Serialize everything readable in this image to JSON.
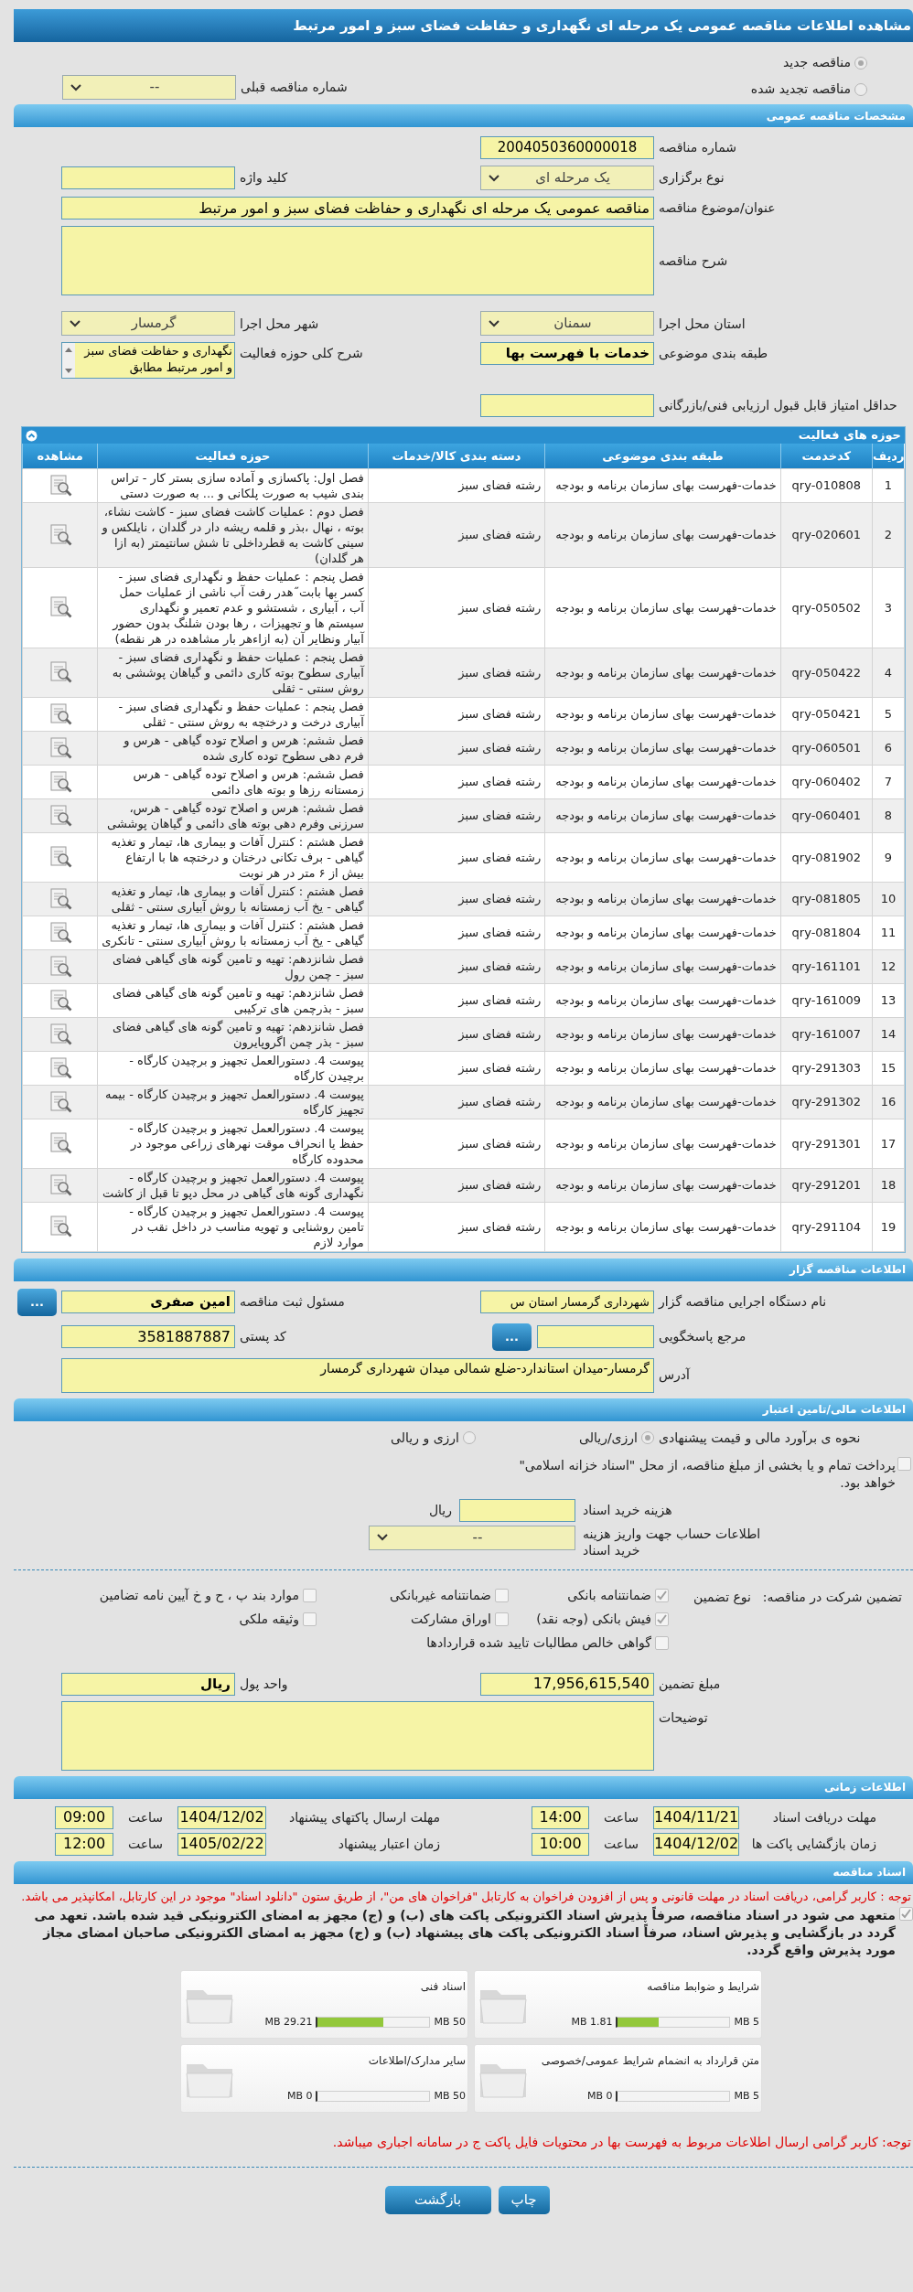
{
  "title": "مشاهده اطلاعات مناقصه عمومی یک مرحله ای نگهداری و حفاظت فضای سبز و امور مرتبط",
  "tender_type": [
    {
      "label": "مناقصه جدید",
      "selected": true
    },
    {
      "label": "مناقصه تجدید شده",
      "selected": false
    }
  ],
  "previous_tender": {
    "label": "شماره مناقصه قبلی",
    "value": "--"
  },
  "general": {
    "header": "مشخصات مناقصه عمومی",
    "tender_number": {
      "label": "شماره مناقصه",
      "value": "2004050360000018"
    },
    "holding_type": {
      "label": "نوع برگزاری",
      "value": "یک مرحله ای"
    },
    "keyword": {
      "label": "کلید واژه"
    },
    "subject": {
      "label": "عنوان/موضوع مناقصه",
      "value": "مناقصه عمومی یک مرحله ای نگهداری و حفاظت فضای سبز و امور مرتبط"
    },
    "description": {
      "label": "شرح مناقصه"
    },
    "province": {
      "label": "استان محل اجرا",
      "value": "سمنان"
    },
    "city": {
      "label": "شهر محل اجرا",
      "value": "گرمسار"
    },
    "category": {
      "label": "طبقه بندی موضوعی",
      "value": "خدمات با فهرست بها"
    },
    "activity_summary": {
      "label": "شرح کلی حوزه فعالیت",
      "value": "نگهداری و حفاظت فضای سبز و امور مرتبط مطابق"
    },
    "min_score": {
      "label": "حداقل امتیاز قابل قبول ارزیابی فنی/بازرگانی"
    }
  },
  "activities": {
    "header": "حوزه های فعالیت",
    "columns": [
      "ردیف",
      "کدخدمت",
      "طبقه بندی موضوعی",
      "دسته بندی کالا/خدمات",
      "حوزه فعالیت",
      "مشاهده"
    ],
    "rows": [
      {
        "index": "1",
        "code": "qry-010808",
        "category": "خدمات-فهرست بهای سازمان برنامه و بودجه",
        "group": "رشته فضای سبز",
        "activity": "فصل اول:  پاکسازی و آماده سازی بستر کار - تراس بندی شیب به صورت پلکانی و ... به صورت دستی"
      },
      {
        "index": "2",
        "code": "qry-020601",
        "category": "خدمات-فهرست بهای سازمان برنامه و بودجه",
        "group": "رشته فضای سبز",
        "activity": "فصل دوم : عملیات کاشت فضای سبز -  کاشت نشاء، بوته ، نهال ،بذر و قلمه ریشه دار در گلدان ، نایلکس و سینی کاشت به قطرداخلی تا شش سانتیمتر (به ازا هر  گلدان)"
      },
      {
        "index": "3",
        "code": "qry-050502",
        "category": "خدمات-فهرست بهای سازمان برنامه و بودجه",
        "group": "رشته فضای سبز",
        "activity": "فصل پنجم : عملیات حفظ و نگهداری فضای سبز - کسر بها بابت˝هدر رفت آب ناشی از عملیات حمل آب ، آبیاری ، شستشو و عدم تعمیر و نگهداری سیستم ها و تجهیزات ، رها بودن شلنگ بدون حضور آبیار ونظایر آن (به ازاءهر بار مشاهده در هر نقطه)"
      },
      {
        "index": "4",
        "code": "qry-050422",
        "category": "خدمات-فهرست بهای سازمان برنامه و بودجه",
        "group": "رشته فضای سبز",
        "activity": "فصل پنجم : عملیات حفظ و نگهداری فضای سبز - آبیاری سطوح بوته کاری دائمی  و گیاهان پوششی به روش سنتی - ثقلی"
      },
      {
        "index": "5",
        "code": "qry-050421",
        "category": "خدمات-فهرست بهای سازمان برنامه و بودجه",
        "group": "رشته فضای سبز",
        "activity": "فصل پنجم : عملیات حفظ و نگهداری فضای سبز - آبیاری درخت و درختچه به روش  سنتی - ثقلی"
      },
      {
        "index": "6",
        "code": "qry-060501",
        "category": "خدمات-فهرست بهای سازمان برنامه و بودجه",
        "group": "رشته فضای سبز",
        "activity": "فصل ششم: هرس و اصلاح توده گیاهی - هرس و فرم دهی سطوح توده کاری شده"
      },
      {
        "index": "7",
        "code": "qry-060402",
        "category": "خدمات-فهرست بهای سازمان برنامه و بودجه",
        "group": "رشته فضای سبز",
        "activity": "فصل ششم: هرس و اصلاح توده گیاهی - هرس زمستانه رزها و بوته های دائمی"
      },
      {
        "index": "8",
        "code": "qry-060401",
        "category": "خدمات-فهرست بهای سازمان برنامه و بودجه",
        "group": "رشته فضای سبز",
        "activity": "فصل ششم: هرس و اصلاح توده گیاهی - هرس، سرزنی  وفرم دهی بوته های دائمی و گیاهان پوششی"
      },
      {
        "index": "9",
        "code": "qry-081902",
        "category": "خدمات-فهرست بهای سازمان برنامه و بودجه",
        "group": "رشته فضای سبز",
        "activity": "فصل هشتم : کنترل آفات و بیماری ها، تیمار و تغذیه گیاهی - برف تکانی درختان و درختچه ها با ارتفاع بیش از ۶ متر در هر نوبت"
      },
      {
        "index": "10",
        "code": "qry-081805",
        "category": "خدمات-فهرست بهای سازمان برنامه و بودجه",
        "group": "رشته فضای سبز",
        "activity": "فصل هشتم : کنترل آفات و بیماری ها، تیمار و تغذیه گیاهی - یخ آب زمستانه با روش آبیاری سنتی - ثقلی"
      },
      {
        "index": "11",
        "code": "qry-081804",
        "category": "خدمات-فهرست بهای سازمان برنامه و بودجه",
        "group": "رشته فضای سبز",
        "activity": "فصل هشتم : کنترل آفات و بیماری ها، تیمار و تغذیه گیاهی - یخ آب زمستانه با روش آبیاری سنتی - تانکری"
      },
      {
        "index": "12",
        "code": "qry-161101",
        "category": "خدمات-فهرست بهای سازمان برنامه و بودجه",
        "group": "رشته فضای سبز",
        "activity": "فصل شانزدهم: تهیه و تامین گونه های گیاهی فضای سبز - چمن رول"
      },
      {
        "index": "13",
        "code": "qry-161009",
        "category": "خدمات-فهرست بهای سازمان برنامه و بودجه",
        "group": "رشته فضای سبز",
        "activity": "فصل شانزدهم: تهیه و تامین گونه های گیاهی فضای سبز - بذرچمن های ترکیبی"
      },
      {
        "index": "14",
        "code": "qry-161007",
        "category": "خدمات-فهرست بهای سازمان برنامه و بودجه",
        "group": "رشته فضای سبز",
        "activity": "فصل شانزدهم: تهیه و تامین گونه های گیاهی فضای سبز - بذر چمن اگروپایرون"
      },
      {
        "index": "15",
        "code": "qry-291303",
        "category": "خدمات-فهرست بهای سازمان برنامه و بودجه",
        "group": "رشته فضای سبز",
        "activity": "پیوست 4. دستورالعمل تجهیز و برچیدن کارگاه - برچیدن کارگاه"
      },
      {
        "index": "16",
        "code": "qry-291302",
        "category": "خدمات-فهرست بهای سازمان برنامه و بودجه",
        "group": "رشته فضای سبز",
        "activity": "پیوست 4. دستورالعمل تجهیز و برچیدن کارگاه - بیمه تجهیز کارگاه"
      },
      {
        "index": "17",
        "code": "qry-291301",
        "category": "خدمات-فهرست بهای سازمان برنامه و بودجه",
        "group": "رشته فضای سبز",
        "activity": "پیوست 4. دستورالعمل تجهیز و برچیدن کارگاه - حفظ یا انحراف موقت نهرهای زراعی موجود در محدوده کارگاه"
      },
      {
        "index": "18",
        "code": "qry-291201",
        "category": "خدمات-فهرست بهای سازمان برنامه و بودجه",
        "group": "رشته فضای سبز",
        "activity": "پیوست 4. دستورالعمل تجهیز و برچیدن کارگاه - نگهداری گونه های گیاهی در محل دپو تا قبل از کاشت"
      },
      {
        "index": "19",
        "code": "qry-291104",
        "category": "خدمات-فهرست بهای سازمان برنامه و بودجه",
        "group": "رشته فضای سبز",
        "activity": "پیوست 4. دستورالعمل تجهیز و برچیدن کارگاه - تامین روشنایی و تهویه مناسب در داخل نقب در موارد لازم"
      }
    ]
  },
  "organizer": {
    "header": "اطلاعات مناقصه گزار",
    "org_name": {
      "label": "نام دستگاه اجرایی مناقصه گزار",
      "value": "شهرداری گرمسار استان س"
    },
    "registrar": {
      "label": "مسئول ثبت مناقصه",
      "value": "امین صفری",
      "button": "..."
    },
    "responder": {
      "label": "مرجع پاسخگویی",
      "button": "..."
    },
    "postal_code": {
      "label": "کد پستی",
      "value": "3581887887"
    },
    "address": {
      "label": "آدرس",
      "value": "گرمسار-میدان استاندارد-ضلع شمالی میدان شهرداری گرمسار"
    }
  },
  "financial": {
    "header": "اطلاعات مالی/تامین اعتبار",
    "estimate": {
      "label": "نحوه ی برآورد مالی و قیمت پیشنهادی",
      "options": [
        {
          "label": "ارزی/ریالی",
          "selected": true
        },
        {
          "label": "ارزی و ریالی",
          "selected": false
        }
      ]
    },
    "treasury": {
      "label": "پرداخت تمام و یا بخشی از مبلغ مناقصه، از محل \"اسناد خزانه اسلامی\" خواهد بود.",
      "checked": false
    },
    "doc_fee": {
      "label": "هزینه خرید اسناد",
      "unit": "ریال"
    },
    "account": {
      "label": "اطلاعات حساب جهت واریز هزینه خرید اسناد",
      "value": "--"
    },
    "guarantee": {
      "label": "تضمین شرکت در مناقصه:",
      "type_label": "نوع تضمین",
      "options": [
        {
          "label": "ضمانتنامه بانکی",
          "checked": true
        },
        {
          "label": "ضمانتنامه غیربانکی",
          "checked": false
        },
        {
          "label": "موارد بند پ ، ح و خ آیین نامه تضامین",
          "checked": false
        },
        {
          "label": "فیش بانکی (وجه نقد)",
          "checked": true
        },
        {
          "label": "اوراق مشارکت",
          "checked": false
        },
        {
          "label": "وثیقه ملکی",
          "checked": false
        },
        {
          "label": "گواهی خالص مطالبات تایید شده قراردادها",
          "checked": false
        }
      ]
    },
    "amount": {
      "label": "مبلغ تضمین",
      "value": "17,956,615,540"
    },
    "currency": {
      "label": "واحد پول",
      "value": "ریال"
    },
    "notes": {
      "label": "توضیحات"
    }
  },
  "timing": {
    "header": "اطلاعات زمانی",
    "items": [
      {
        "label": "مهلت دریافت اسناد",
        "date": "1404/11/21",
        "time_label": "ساعت",
        "time": "14:00"
      },
      {
        "label": "مهلت ارسال پاکتهای پیشنهاد",
        "date": "1404/12/02",
        "time_label": "ساعت",
        "time": "09:00"
      },
      {
        "label": "زمان بازگشایی پاکت ها",
        "date": "1404/12/02",
        "time_label": "ساعت",
        "time": "10:00"
      },
      {
        "label": "زمان اعتبار پیشنهاد",
        "date": "1405/02/22",
        "time_label": "ساعت",
        "time": "12:00"
      }
    ]
  },
  "documents": {
    "header": "اسناد مناقصه",
    "notice": "توجه : کاربر گرامی، دریافت اسناد در مهلت قانونی و پس از افزودن فراخوان به کارتابل \"فراخوان های من\"، از طریق ستون \"دانلود اسناد\" موجود در این کارتابل، امکانپذیر می باشد.",
    "commitment": {
      "text": "متعهد می شود در اسناد مناقصه، صرفاً پذیرش اسناد الکترونیکی پاکت های (ب) و (ج) مجهز به امضای الکترونیکی قید شده باشد. تعهد می گردد در بازگشایی و پذیرش اسناد، صرفاً اسناد الکترونیکی پاکت های پیشنهاد (ب) و (ج) مجهز به امضای الکترونیکی صاحبان امضای مجاز مورد پذیرش واقع گردد.",
      "checked": true
    },
    "files": [
      {
        "title": "شرایط و ضوابط مناقصه",
        "size": "1.81 MB",
        "limit": "5 MB",
        "level": 0.362
      },
      {
        "title": "اسناد فنی",
        "size": "29.21 MB",
        "limit": "50 MB",
        "level": 0.584
      },
      {
        "title": "متن قرارداد به انضمام شرایط عمومی/خصوصی",
        "size": "0 MB",
        "limit": "5 MB",
        "level": 0
      },
      {
        "title": "سایر مدارک/اطلاعات",
        "size": "0 MB",
        "limit": "50 MB",
        "level": 0
      }
    ],
    "footer_note": "توجه: کاربر گرامی ارسال اطلاعات مربوط به فهرست بها در محتویات فایل پاکت ج در سامانه اجباری میباشد."
  },
  "buttons": [
    "چاپ",
    "بازگشت"
  ]
}
